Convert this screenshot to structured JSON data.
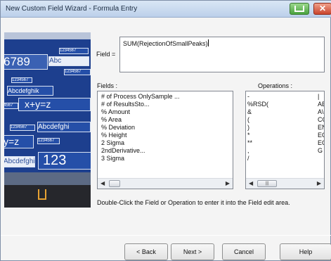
{
  "window": {
    "title": "New Custom Field Wizard - Formula Entry"
  },
  "title_buttons": {
    "help_icon": "help-icon",
    "close_symbol": "✕"
  },
  "banner": {
    "t1": "6789",
    "t2": "Abc",
    "t3": "1234567",
    "t4": "1234567",
    "t5": "Abcdefghik",
    "t6": "x+y=z",
    "t7": "4567",
    "t8": "1234567",
    "t9": "Abcdefghi",
    "t10": "y=z",
    "t11": "1234567",
    "t12": "Abcdefghi",
    "t13": "123",
    "t14": "1234567"
  },
  "formula": {
    "label": "Field =",
    "value": "SUM(RejectionOfSmallPeaks)"
  },
  "fields": {
    "label": "Fields :",
    "items": [
      "# of Process OnlySample ...",
      "# of ResultsSto...",
      "% Amount",
      "% Area",
      "% Deviation",
      "% Height",
      "2 Sigma",
      "2ndDerivative...",
      "3 Sigma"
    ]
  },
  "operations": {
    "label": "Operations :",
    "items": [
      {
        "a": "-",
        "b": "|"
      },
      {
        "a": "%RSD(",
        "b": "AE"
      },
      {
        "a": "&",
        "b": "A\\"
      },
      {
        "a": "(",
        "b": "CC"
      },
      {
        "a": ")",
        "b": "EN"
      },
      {
        "a": "*",
        "b": "EC"
      },
      {
        "a": "**",
        "b": "EC"
      },
      {
        "a": ",",
        "b": "G"
      },
      {
        "a": "/",
        "b": ""
      }
    ],
    "scroll_thumb_glyph": "|||"
  },
  "scroll": {
    "left": "◀",
    "right": "▶"
  },
  "hint": "Double-Click the Field or Operation to enter it into the Field edit area.",
  "buttons": {
    "back": "< Back",
    "next": "Next >",
    "cancel": "Cancel",
    "help": "Help"
  }
}
